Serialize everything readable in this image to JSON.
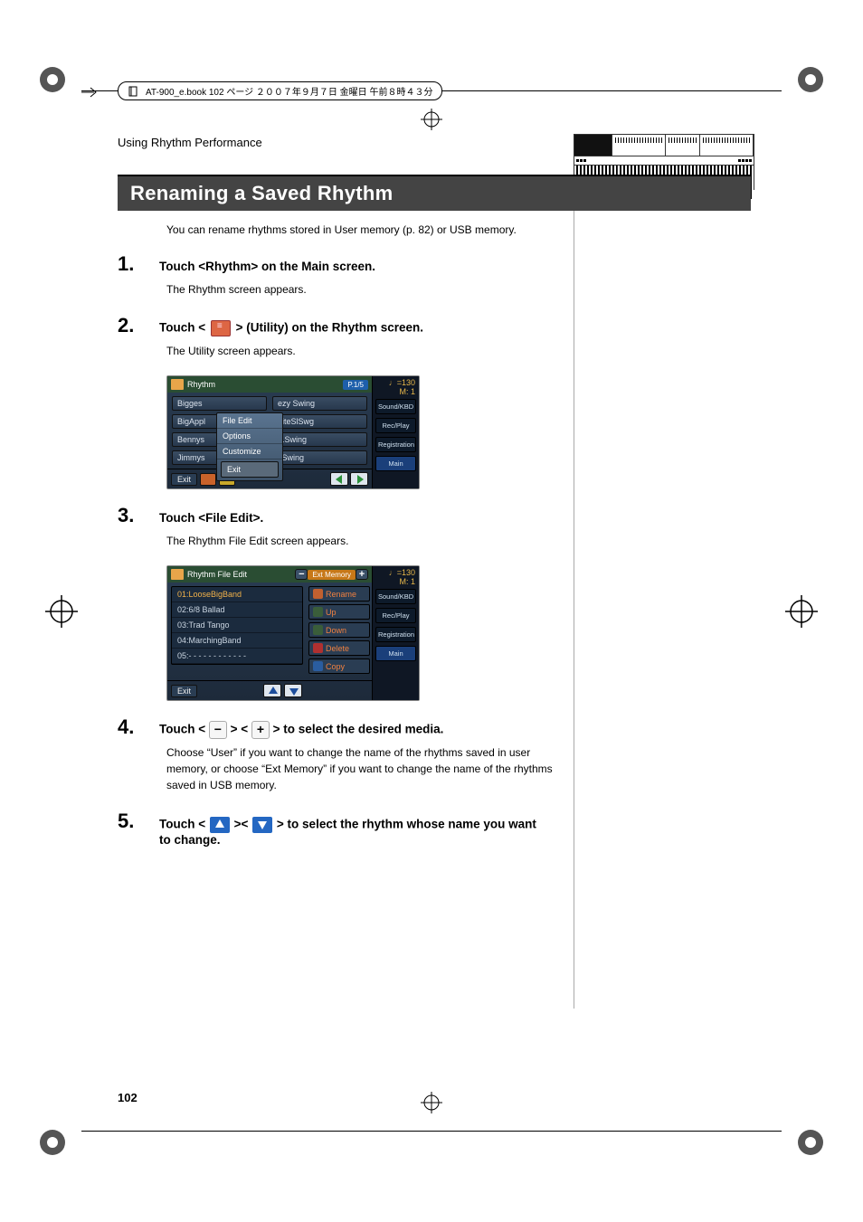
{
  "header_info": "AT-900_e.book 102 ページ ２００７年９月７日 金曜日 午前８時４３分",
  "section_header": "Using Rhythm Performance",
  "title": "Renaming a Saved Rhythm",
  "intro": "You can rename rhythms stored in User memory (p. 82) or USB memory.",
  "steps": {
    "s1": {
      "num": "1.",
      "title": "Touch <Rhythm> on the Main screen.",
      "body": "The Rhythm screen appears."
    },
    "s2": {
      "num": "2.",
      "title_pre": "Touch < ",
      "title_post": " > (Utility) on the Rhythm screen.",
      "body": "The Utility screen appears."
    },
    "s3": {
      "num": "3.",
      "title": "Touch <File Edit>.",
      "body": "The Rhythm File Edit screen appears."
    },
    "s4": {
      "num": "4.",
      "title_pre": "Touch < ",
      "title_mid": " > < ",
      "title_post": " > to select the desired media.",
      "body": "Choose “User” if you want to change the name of the rhythms saved in user memory, or choose “Ext Memory” if you want to change the name of the rhythms saved in USB memory."
    },
    "s5": {
      "num": "5.",
      "title_pre": "Touch < ",
      "title_mid": " >< ",
      "title_post": " > to select the rhythm whose name you want to change."
    }
  },
  "shot1": {
    "title": "Rhythm",
    "page_pill": "P.1/5",
    "left_items": [
      "Bigges",
      "BigAppl",
      "Bennys",
      "Jimmys"
    ],
    "right_items": [
      "ezy Swing",
      "hiteSlSwg",
      "h.Swing",
      "l Swing"
    ],
    "menu": {
      "file_edit": "File Edit",
      "options": "Options",
      "customize": "Customize",
      "exit": "Exit"
    },
    "bottom": {
      "exit": "Exit"
    },
    "side": {
      "tempo": "♩=130",
      "m": "M:    1",
      "sound": "Sound/KBD",
      "rec": "Rec/Play",
      "reg": "Registration",
      "main": "Main"
    }
  },
  "shot2": {
    "title": "Rhythm File Edit",
    "mem_label": "Ext Memory",
    "files": [
      "01:LooseBigBand",
      "02:6/8 Ballad",
      "03:Trad Tango",
      "04:MarchingBand",
      "05:- - - - - - - - - - - -"
    ],
    "actions": {
      "rename": "Rename",
      "up": "Up",
      "down": "Down",
      "delete": "Delete",
      "copy": "Copy"
    },
    "bottom": {
      "exit": "Exit"
    },
    "side": {
      "tempo": "♩=130",
      "m": "M:    1",
      "sound": "Sound/KBD",
      "rec": "Rec/Play",
      "reg": "Registration",
      "main": "Main"
    }
  },
  "page_num": "102"
}
